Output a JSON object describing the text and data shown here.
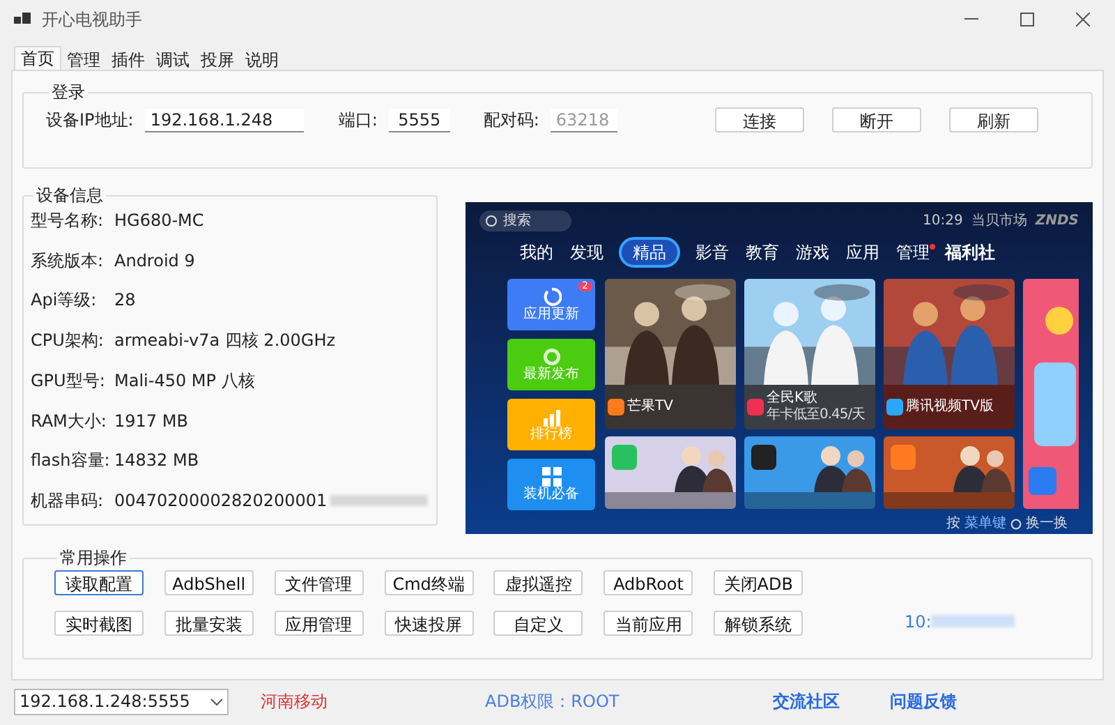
{
  "window": {
    "title": "开心电视助手"
  },
  "tabs": [
    {
      "label": "首页",
      "selected": true
    },
    {
      "label": "管理",
      "selected": false
    },
    {
      "label": "插件",
      "selected": false
    },
    {
      "label": "调试",
      "selected": false
    },
    {
      "label": "投屏",
      "selected": false
    },
    {
      "label": "说明",
      "selected": false
    }
  ],
  "login": {
    "title": "登录",
    "fields": [
      {
        "label": "设备IP地址:",
        "value": "192.168.1.248"
      },
      {
        "label": "端口:",
        "value": "5555"
      },
      {
        "label": "配对码:",
        "placeholder": "63218"
      }
    ],
    "buttons": [
      "连接",
      "断开",
      "刷新"
    ]
  },
  "device_info": {
    "title": "设备信息",
    "rows": [
      {
        "label": "型号名称:",
        "value": "HG680-MC"
      },
      {
        "label": "系统版本:",
        "value": "Android 9"
      },
      {
        "label": "Api等级:",
        "value": "28"
      },
      {
        "label": "CPU架构:",
        "value": "armeabi-v7a 四核 2.00GHz"
      },
      {
        "label": "GPU型号:",
        "value": "Mali-450 MP 八核"
      },
      {
        "label": "RAM大小:",
        "value": "1917 MB"
      },
      {
        "label": "flash容量:",
        "value": "14832 MB"
      },
      {
        "label": "机器串码:",
        "value": "00470200002820200001",
        "blurred": true
      }
    ]
  },
  "tv_screen": {
    "search": "搜索",
    "time": "10:29",
    "store": "当贝市场",
    "brand": "ZNDS",
    "nav": [
      {
        "label": "我的",
        "selected": false,
        "dot": false
      },
      {
        "label": "发现",
        "selected": false,
        "dot": false
      },
      {
        "label": "精品",
        "selected": true,
        "dot": false
      },
      {
        "label": "影音",
        "selected": false,
        "dot": false
      },
      {
        "label": "教育",
        "selected": false,
        "dot": false
      },
      {
        "label": "游戏",
        "selected": false,
        "dot": false
      },
      {
        "label": "应用",
        "selected": false,
        "dot": false
      },
      {
        "label": "管理",
        "selected": false,
        "dot": true
      }
    ],
    "promo": "福利社",
    "tiles": [
      {
        "label": "应用更新",
        "color": "#3d7cf5",
        "badge": "2"
      },
      {
        "label": "最新发布",
        "color": "#4ccc10"
      },
      {
        "label": "排行榜",
        "color": "#ffb000"
      },
      {
        "label": "装机必备",
        "color": "#1e8ff0"
      }
    ],
    "cards": [
      {
        "title": "芒果TV"
      },
      {
        "title": "全民K歌",
        "subtitle": "年卡低至0.45/天"
      },
      {
        "title": "腾讯视频TV版"
      }
    ],
    "hint": {
      "before": "按",
      "key": "菜单键",
      "after": "换一换"
    }
  },
  "actions": {
    "title": "常用操作",
    "buttons": [
      {
        "label": "读取配置",
        "focused": true
      },
      {
        "label": "AdbShell",
        "focused": false
      },
      {
        "label": "文件管理",
        "focused": false
      },
      {
        "label": "Cmd终端",
        "focused": false
      },
      {
        "label": "虚拟遥控",
        "focused": false
      },
      {
        "label": "AdbRoot",
        "focused": false
      },
      {
        "label": "关闭ADB",
        "focused": false
      },
      {
        "label": "实时截图",
        "focused": false
      },
      {
        "label": "批量安装",
        "focused": false
      },
      {
        "label": "应用管理",
        "focused": false
      },
      {
        "label": "快速投屏",
        "focused": false
      },
      {
        "label": "自定义",
        "focused": false
      },
      {
        "label": "当前应用",
        "focused": false
      },
      {
        "label": "解锁系统",
        "focused": false
      }
    ],
    "clock": "10:"
  },
  "status_bar": {
    "device": "192.168.1.248:5555",
    "carrier": "河南移动",
    "adb": "ADB权限：ROOT",
    "links": [
      "交流社区",
      "问题反馈"
    ]
  }
}
